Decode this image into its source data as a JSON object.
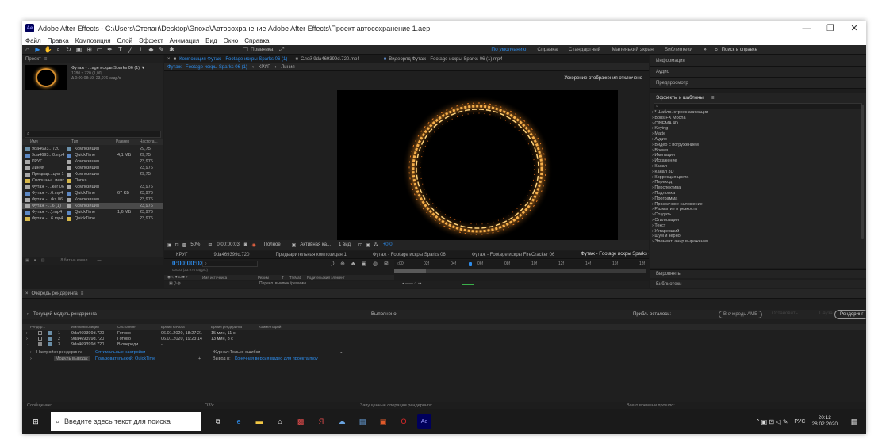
{
  "window": {
    "title": "Adobe After Effects - C:\\Users\\Степан\\Desktop\\Эпоха\\Автосохранение Adobe After Effects\\Проект автосохранение 1.aep",
    "app_icon": "Ae",
    "min": "—",
    "restore": "❐",
    "close": "✕"
  },
  "menu": [
    "Файл",
    "Правка",
    "Композиция",
    "Слой",
    "Эффект",
    "Анимация",
    "Вид",
    "Окно",
    "Справка"
  ],
  "toolbar": {
    "snap_label": "Привязка",
    "workspaces": [
      "По умолчанию",
      "Справка",
      "Стандартный",
      "Маленький экран",
      "Библиотеки"
    ],
    "active_workspace": "По умолчанию",
    "more": "»",
    "search_placeholder": "Поиск в справке"
  },
  "project": {
    "tab": "Проект",
    "selected_name": "Футаж - ...age искры Sparks 06 (1) ▼",
    "selected_info1": "1280 x 720 (1,00)",
    "selected_info2": "Δ 0:00:08:19, 23,976 кадр/с",
    "columns": [
      "Имя",
      "Тип",
      "Размер",
      "Частота..."
    ],
    "items": [
      {
        "name": "9da4693...720",
        "type": "Композиция",
        "size": "",
        "fps": "29,75",
        "color": "#6b8fa8",
        "selected": false
      },
      {
        "name": "9da4693...0.mp4",
        "type": "QuickTime",
        "size": "4,1 МБ",
        "fps": "29,75",
        "color": "#5d88c4",
        "selected": false
      },
      {
        "name": "КРУГ",
        "type": "Композиция",
        "size": "",
        "fps": "23,976",
        "color": "#a8a8a8",
        "selected": false
      },
      {
        "name": "Линия",
        "type": "Композиция",
        "size": "",
        "fps": "23,976",
        "color": "#a8a8a8",
        "selected": false
      },
      {
        "name": "Предвар...ция 1",
        "type": "Композиция",
        "size": "",
        "fps": "29,75",
        "color": "#a8a8a8",
        "selected": false
      },
      {
        "name": "Сплошны...иевк",
        "type": "Папка",
        "size": "",
        "fps": "",
        "color": "#d6b74a",
        "selected": false
      },
      {
        "name": "Футаж - ...ker 06",
        "type": "Композиция",
        "size": "",
        "fps": "23,976",
        "color": "#a8a8a8",
        "selected": false
      },
      {
        "name": "Футаж -...6.mp4",
        "type": "QuickTime",
        "size": "67 KБ",
        "fps": "23,976",
        "color": "#5d88c4",
        "selected": false
      },
      {
        "name": "Футаж -...rks 06",
        "type": "Композиция",
        "size": "",
        "fps": "23,976",
        "color": "#a8a8a8",
        "selected": false
      },
      {
        "name": "Футаж - ...6 (1)",
        "type": "Композиция",
        "size": "",
        "fps": "23,976",
        "color": "#a8a8a8",
        "selected": true
      },
      {
        "name": "Футаж -...).mp4",
        "type": "QuickTime",
        "size": "1,6 МБ",
        "fps": "23,976",
        "color": "#5d88c4",
        "selected": false
      },
      {
        "name": "Футаж -...6.mp4",
        "type": "QuickTime",
        "size": "",
        "fps": "23,976",
        "color": "#d6b74a",
        "selected": false
      }
    ],
    "bpc": "8 бит на канал"
  },
  "viewer": {
    "tabs": [
      {
        "label": "Композиция Футаж - Footage искры Sparks 06 (1)",
        "active": true
      },
      {
        "label": "Слой 9da469399d.720.mp4",
        "active": false
      },
      {
        "label": "Видеоряд Футаж - Footage искры Sparks 06 (1).mp4",
        "active": false
      }
    ],
    "subtabs": [
      "Футаж - Footage искры Sparks 06 (1)",
      "КРУГ",
      "Линия"
    ],
    "notice": "Ускорение отображения отключено",
    "zoom": "50%",
    "timecode": "0:00:00:03",
    "quality": "Полное",
    "camera": "Активная ка...",
    "views": "1 вид",
    "exposure": "+0,0"
  },
  "timeline": {
    "tabs": [
      {
        "label": "КРУГ",
        "color": "#a8a8a8"
      },
      {
        "label": "9da469399d.720",
        "color": "#6b8fa8"
      },
      {
        "label": "Предварительная композиция 1",
        "color": "#a8a8a8"
      },
      {
        "label": "Футаж - Footage искры Sparks 06",
        "color": "#a8a8a8"
      },
      {
        "label": "Футаж - Footage искры FireCracker 06",
        "color": "#d6b74a"
      },
      {
        "label": "Футаж - Footage искры Sparks 06 (1)",
        "color": "#a8a8a8",
        "active": true
      },
      {
        "label": "Линия",
        "color": "#a8a8a8"
      }
    ],
    "timecode": "0:00:00:03",
    "timecode_sub": "00003 (23.976 кадр/с)",
    "ruler": [
      "):00f",
      "02f",
      "04f",
      "06f",
      "08f",
      "10f",
      "12f",
      "14f",
      "16f",
      "18f"
    ],
    "col_headers": [
      "Имя источника",
      "Режим",
      "T",
      "TrkMat",
      "Родительский элемент"
    ],
    "switch_label": "Перекл. выключ./режимы"
  },
  "effects": {
    "items": [
      "Информация",
      "Аудио",
      "Предпросмотр"
    ],
    "tab": "Эффекты и шаблоны",
    "list": [
      "* Шабло..строек анимации",
      "Boris FX Mocha",
      "CINEMA 4D",
      "Keying",
      "Matte",
      "Аудио",
      "Видео с погружением",
      "Время",
      "Имитация",
      "Искажение",
      "Канал",
      "Канал 3D",
      "Коррекция цвета",
      "Переход",
      "Перспектива",
      "Подложка",
      "Программа",
      "Прозрачное наложение",
      "Размытие и резкость",
      "Создать",
      "Стилизация",
      "Текст",
      "Устаревший",
      "Шум и зерно",
      "Элемент..анир выражения"
    ],
    "align": "Выровнять",
    "libs": "Библиотеки"
  },
  "render": {
    "tab": "Очередь рендеринга",
    "current": "Текущий модуль рендеринга",
    "done_label": "Выполнено:",
    "remain_label": "Прибл. осталось:",
    "ame_btn": "В очередь AME",
    "stop_btn": "Остановить",
    "pause_btn": "Пауза",
    "render_btn": "Рендеринг",
    "columns": [
      "Рендер...",
      "Имя композиции",
      "Состояние",
      "Время начала",
      "Время рендеринга",
      "Комментарий"
    ],
    "rows": [
      {
        "num": "1",
        "name": "9da469399d.720",
        "status": "Готово",
        "start": "06.01.2020, 18:27:21",
        "time": "15 мин, 11 с"
      },
      {
        "num": "2",
        "name": "9da469399d.720",
        "status": "Готово",
        "start": "06.01.2020, 19:23:14",
        "time": "13 мин, 3 с"
      },
      {
        "num": "3",
        "name": "9da469399d.720",
        "status": "В очереди",
        "start": "-",
        "time": ""
      }
    ],
    "settings_label": "Настройки рендеринга",
    "settings_value": "Оптимальные настройки",
    "log_label": "Журнал:",
    "log_value": "Только ошибки",
    "module_label": "Модуль вывода:",
    "module_value": "Пользовательский: QuickTime",
    "output_label": "Вывод в:",
    "output_value": "Конечная версия видео для проекта.mov"
  },
  "status": {
    "messages": "Сообщение:",
    "ram": "ОЗУ:",
    "renders": "Запущенные операции рендеринга:",
    "elapsed": "Всего времени прошло:"
  },
  "taskbar": {
    "search_placeholder": "Введите здесь текст для поиска",
    "lang": "РУС",
    "time": "20:12",
    "date": "28.02.2020"
  }
}
